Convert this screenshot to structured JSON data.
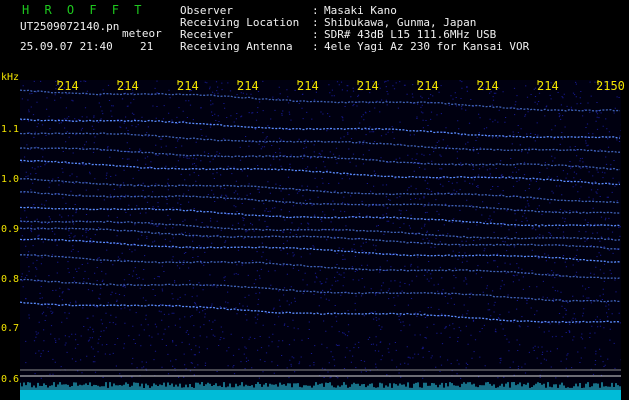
{
  "header": {
    "title": "H R O F F T",
    "file": "UT2509072140.pn",
    "kind": "meteor",
    "date": "25.09.07 21:40",
    "count": "21",
    "info": [
      {
        "label": "Observer",
        "sep": ":",
        "value": "Masaki Kano"
      },
      {
        "label": "Receiving Location",
        "sep": ":",
        "value": "Shibukawa, Gunma, Japan"
      },
      {
        "label": "Receiver",
        "sep": ":",
        "value": "SDR# 43dB L15 111.6MHz USB"
      },
      {
        "label": "Receiving Antenna",
        "sep": ":",
        "value": "4ele Yagi Az 230 for Kansai VOR"
      }
    ]
  },
  "spectrogram": {
    "y_unit": "kHz",
    "y_ticks": [
      "1.1",
      "1.0",
      "0.9",
      "0.8",
      "0.7",
      "0.6"
    ],
    "time_labels": [
      "214",
      "214",
      "214",
      "214",
      "214",
      "214",
      "214",
      "214",
      "214",
      "2150"
    ],
    "y_range_khz": [
      0.58,
      1.2
    ],
    "colors": {
      "background": "#000010",
      "signal": "#5a8cff",
      "noise": "#1b1fb0",
      "tick": "#f2e400"
    }
  }
}
